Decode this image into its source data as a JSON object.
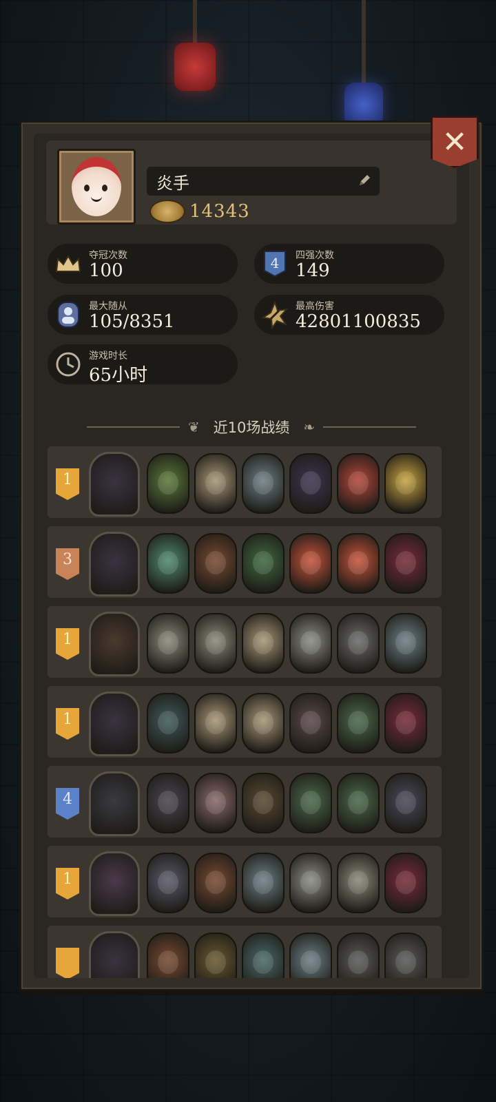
{
  "player": {
    "name": "炎手",
    "coins": "14343"
  },
  "stats": [
    {
      "label": "夺冠次数",
      "value": "100",
      "icon": "crown-icon"
    },
    {
      "label": "四强次数",
      "value": "149",
      "icon": "shield-4-icon"
    },
    {
      "label": "最大随从",
      "value": "105/8351",
      "icon": "minion-icon"
    },
    {
      "label": "最高伤害",
      "value": "42801100835",
      "icon": "damage-star-icon"
    },
    {
      "label": "游戏时长",
      "value": "65小时",
      "icon": "clock-icon"
    }
  ],
  "section_title": "近10场战绩",
  "close_label": "✕",
  "battles": [
    {
      "rank": "1",
      "tier": "gold",
      "hero_color": "#3a3340",
      "units": [
        "#5a7a3a",
        "#a89776",
        "#6d7f86",
        "#3c3450",
        "#b5473a",
        "#c9a440"
      ]
    },
    {
      "rank": "3",
      "tier": "bronze",
      "hero_color": "#3a3340",
      "units": [
        "#4f8a6e",
        "#7a4a30",
        "#3f6a40",
        "#c8533a",
        "#c8533a",
        "#7a2a3a"
      ]
    },
    {
      "rank": "1",
      "tier": "gold",
      "hero_color": "#4a3a2e",
      "units": [
        "#8a8a7a",
        "#8a8a7a",
        "#a89776",
        "#8c8c86",
        "#6b6b6b",
        "#6d7f86"
      ]
    },
    {
      "rank": "1",
      "tier": "gold",
      "hero_color": "#3a3340",
      "units": [
        "#3f5a5a",
        "#a89776",
        "#a89776",
        "#5a4a4a",
        "#4a6a4a",
        "#7a2a3a"
      ]
    },
    {
      "rank": "4",
      "tier": "blue",
      "hero_color": "#3a3a40",
      "units": [
        "#4a4450",
        "#8a6a6a",
        "#5a4a30",
        "#4a6a4a",
        "#4a6a4a",
        "#4a4a5a"
      ]
    },
    {
      "rank": "1",
      "tier": "gold",
      "hero_color": "#4a3a4a",
      "units": [
        "#5a5a6a",
        "#7a4a30",
        "#6d7f86",
        "#8c8c86",
        "#8a8a7a",
        "#7a2a3a"
      ]
    },
    {
      "rank": "",
      "tier": "gold",
      "hero_color": "#3a3340",
      "units": [
        "#7a4a30",
        "#6a5a30",
        "#4a6a6a",
        "#6d7f86",
        "#5a5a5a",
        "#5a5a5a"
      ]
    }
  ]
}
